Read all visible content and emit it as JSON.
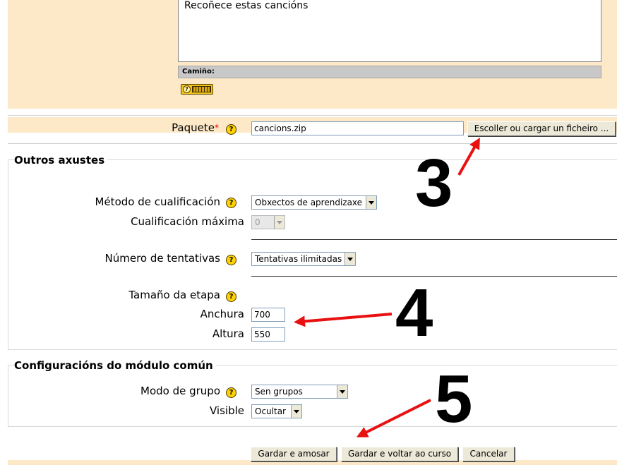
{
  "editor": {
    "text": "Recoñece estas cancións",
    "path_label": "Camiño:"
  },
  "package": {
    "label": "Paquete",
    "required_mark": "*",
    "value": "cancions.zip",
    "choose_button": "Escoller ou cargar un ficheiro ..."
  },
  "other_settings": {
    "legend": "Outros axustes",
    "grading_method_label": "Método de cualificación",
    "grading_method_value": "Obxectos de aprendizaxe",
    "max_grade_label": "Cualificación máxima",
    "max_grade_value": "0",
    "attempts_label": "Número de tentativas",
    "attempts_value": "Tentativas ilimitadas",
    "stage_size_label": "Tamaño da etapa",
    "width_label": "Anchura",
    "width_value": "700",
    "height_label": "Altura",
    "height_value": "550"
  },
  "common_module": {
    "legend": "Configuracións do módulo común",
    "group_mode_label": "Modo de grupo",
    "group_mode_value": "Sen grupos",
    "visible_label": "Visible",
    "visible_value": "Ocultar"
  },
  "buttons": {
    "save_display": "Gardar e amosar",
    "save_return": "Gardar e voltar ao curso",
    "cancel": "Cancelar"
  },
  "annotations": {
    "step3": "3",
    "step4": "4",
    "step5": "5",
    "arrow_color": "#e81010"
  },
  "colors": {
    "panel_bg": "#fde9c8",
    "help_icon": "#ffd200"
  },
  "icons": {
    "help": "help-question-icon",
    "keyboard": "keyboard-icon"
  }
}
